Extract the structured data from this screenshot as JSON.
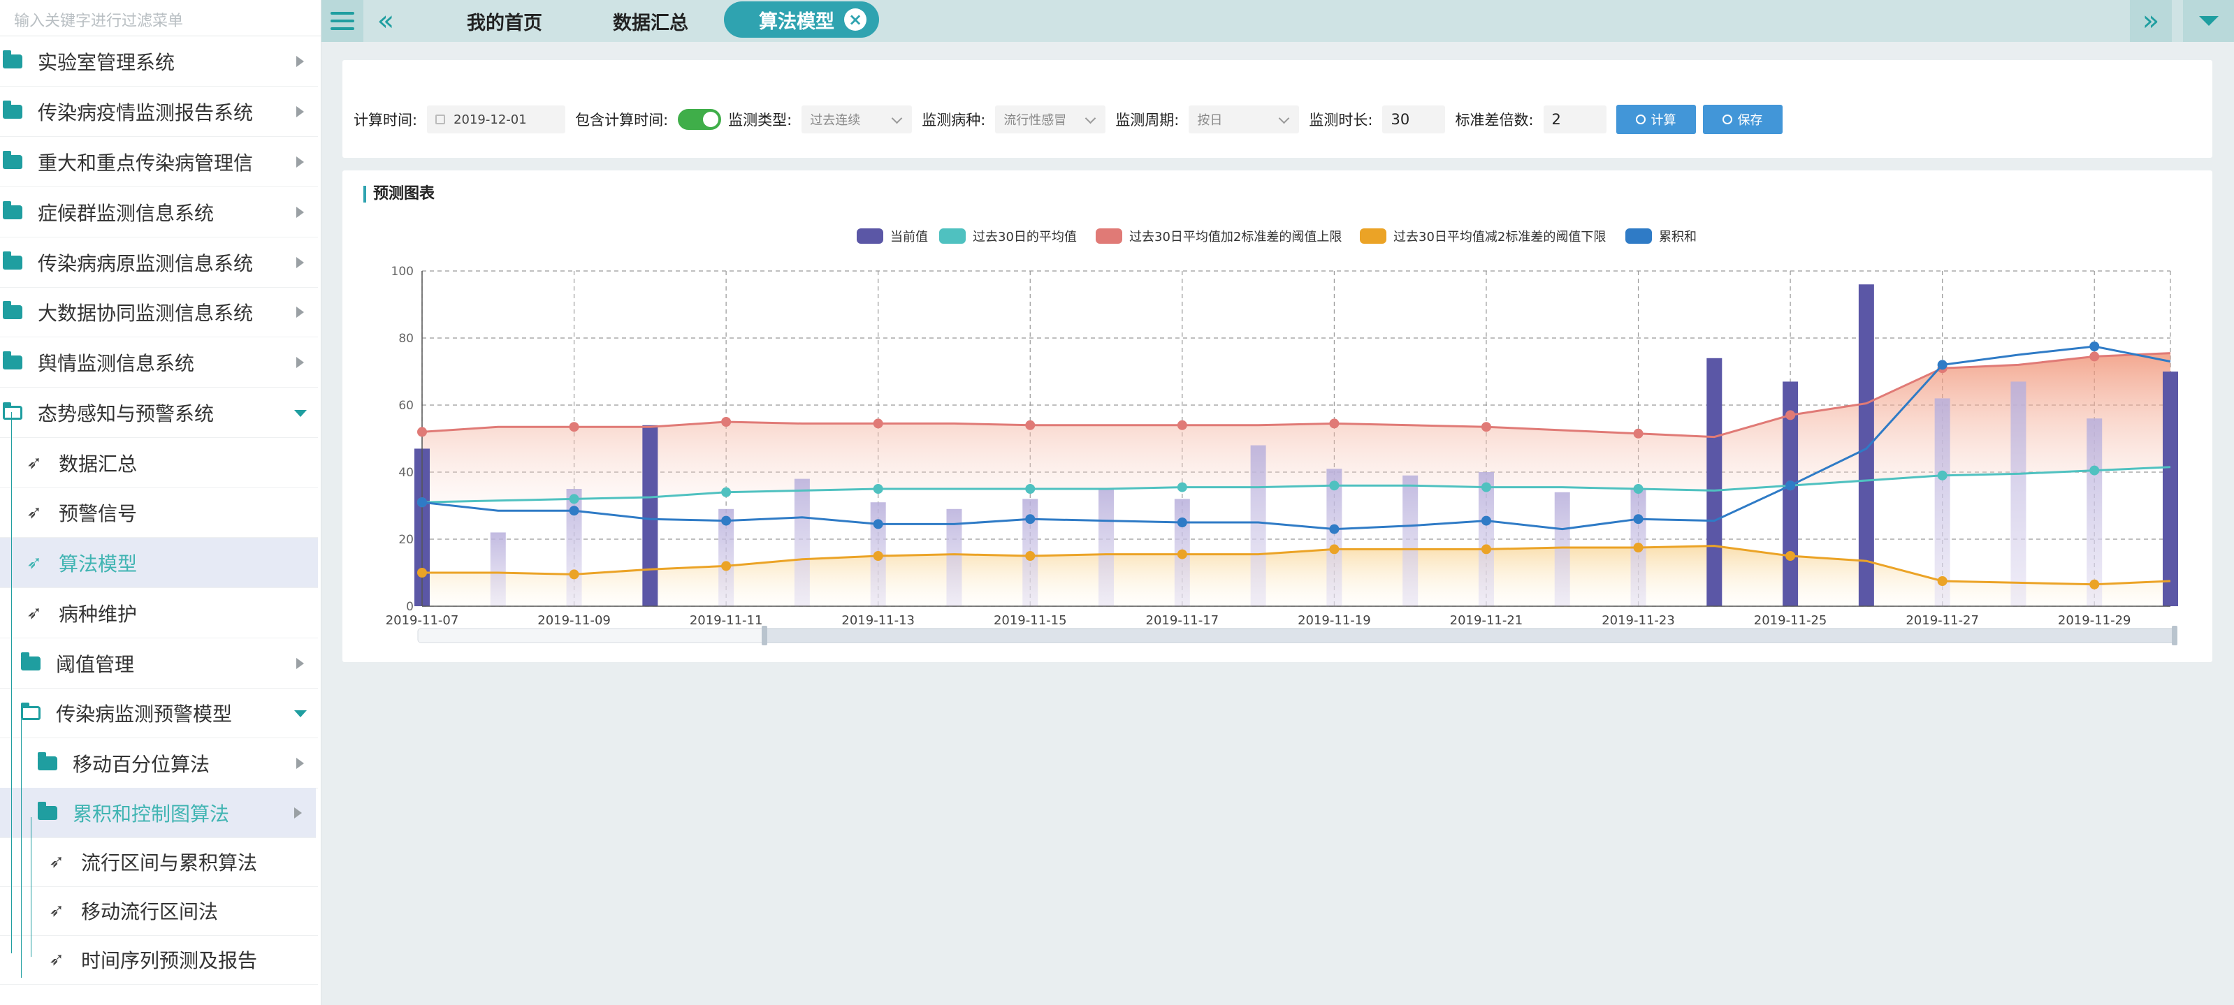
{
  "sidebar": {
    "filter_placeholder": "输入关键字进行过滤菜单",
    "items": [
      {
        "label": "实验室管理系统"
      },
      {
        "label": "传染病疫情监测报告系统"
      },
      {
        "label": "重大和重点传染病管理信"
      },
      {
        "label": "症候群监测信息系统"
      },
      {
        "label": "传染病病原监测信息系统"
      },
      {
        "label": "大数据协同监测信息系统"
      },
      {
        "label": "舆情监测信息系统"
      },
      {
        "label": "态势感知与预警系统"
      },
      {
        "label": "数据汇总"
      },
      {
        "label": "预警信号"
      },
      {
        "label": "算法模型"
      },
      {
        "label": "病种维护"
      },
      {
        "label": "阈值管理"
      },
      {
        "label": "传染病监测预警模型"
      },
      {
        "label": "移动百分位算法"
      },
      {
        "label": "累积和控制图算法"
      },
      {
        "label": "流行区间与累积算法"
      },
      {
        "label": "移动流行区间法"
      },
      {
        "label": "时间序列预测及报告"
      }
    ]
  },
  "tabs": [
    {
      "label": "我的首页"
    },
    {
      "label": "数据汇总"
    },
    {
      "label": "算法模型"
    }
  ],
  "form": {
    "calc_time_label": "计算时间:",
    "calc_time_value": "2019-12-01",
    "include_label": "包含计算时间:",
    "type_label": "监测类型:",
    "type_value": "过去连续",
    "disease_label": "监测病种:",
    "disease_value": "流行性感冒",
    "period_label": "监测周期:",
    "period_value": "按日",
    "length_label": "监测时长:",
    "length_value": "30",
    "std_label": "标准差倍数:",
    "std_value": "2",
    "calc_btn": "计算",
    "save_btn": "保存"
  },
  "chart_title": "预测图表",
  "chart_data": {
    "type": "bar+line",
    "title": "",
    "xlabel": "",
    "ylabel": "",
    "ylim": [
      0,
      100
    ],
    "yticks": [
      0,
      20,
      40,
      60,
      80,
      100
    ],
    "grid": true,
    "legend_position": "top-center",
    "x": [
      "2019-11-07",
      "2019-11-08",
      "2019-11-09",
      "2019-11-10",
      "2019-11-11",
      "2019-11-12",
      "2019-11-13",
      "2019-11-14",
      "2019-11-15",
      "2019-11-16",
      "2019-11-17",
      "2019-11-18",
      "2019-11-19",
      "2019-11-20",
      "2019-11-21",
      "2019-11-22",
      "2019-11-23",
      "2019-11-24",
      "2019-11-25",
      "2019-11-26",
      "2019-11-27",
      "2019-11-28",
      "2019-11-29",
      "2019-11-30"
    ],
    "xtick_labels": [
      "2019-11-07",
      "2019-11-09",
      "2019-11-11",
      "2019-11-13",
      "2019-11-15",
      "2019-11-17",
      "2019-11-19",
      "2019-11-21",
      "2019-11-23",
      "2019-11-25",
      "2019-11-27",
      "2019-11-29"
    ],
    "series": [
      {
        "name": "当前值",
        "type": "bar",
        "color": "#5b57a6",
        "values": [
          47,
          22,
          35,
          54,
          29,
          38,
          31,
          29,
          32,
          35,
          32,
          48,
          41,
          39,
          40,
          34,
          35,
          74,
          67,
          96,
          62,
          67,
          56,
          70
        ]
      },
      {
        "name": "过去30日的平均值",
        "type": "line",
        "color": "#4fc1c0",
        "values": [
          31,
          31.5,
          32,
          32.5,
          34,
          34.5,
          35,
          35,
          35,
          35,
          35.5,
          35.5,
          36,
          36,
          35.5,
          35.5,
          35,
          34.5,
          36,
          37.5,
          39,
          39.5,
          40.5,
          41.5
        ]
      },
      {
        "name": "过去30日平均值加2标准差的阈值上限",
        "type": "line",
        "color": "#e07a76",
        "values": [
          52,
          53.5,
          53.5,
          53.5,
          55,
          54.5,
          54.5,
          54.5,
          54,
          54,
          54,
          54,
          54.5,
          54,
          53.5,
          52.5,
          51.5,
          50.5,
          57,
          60.5,
          71,
          72,
          74.5,
          75.5
        ]
      },
      {
        "name": "过去30日平均值减2标准差的阈值下限",
        "type": "line",
        "color": "#eba326",
        "values": [
          10,
          10,
          9.5,
          11,
          12,
          14,
          15,
          15.5,
          15,
          15.5,
          15.5,
          15.5,
          17,
          17,
          17,
          17.5,
          17.5,
          18,
          15,
          13.5,
          7.5,
          7,
          6.5,
          7.5
        ]
      },
      {
        "name": "累积和",
        "type": "line",
        "color": "#2f7bc6",
        "values": [
          31,
          28.5,
          28.5,
          26,
          25.5,
          26.5,
          24.5,
          24.5,
          26,
          25.5,
          25,
          25,
          23,
          24,
          25.5,
          23,
          26,
          25.5,
          36,
          47,
          72,
          75,
          77.5,
          73
        ]
      }
    ]
  }
}
